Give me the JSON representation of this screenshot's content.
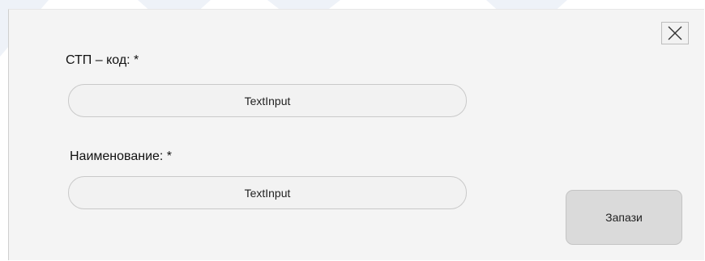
{
  "dialog": {
    "close_icon": "close-icon",
    "code_label": "СТП – код: *",
    "code_input_placeholder": "TextInput",
    "code_input_value": "",
    "name_label": "Наименование: *",
    "name_input_placeholder": "TextInput",
    "name_input_value": "",
    "save_label": "Запази"
  },
  "colors": {
    "dialog_background": "#f4f4f4",
    "input_background": "#f2f2f2",
    "save_button_background": "#dadada"
  }
}
